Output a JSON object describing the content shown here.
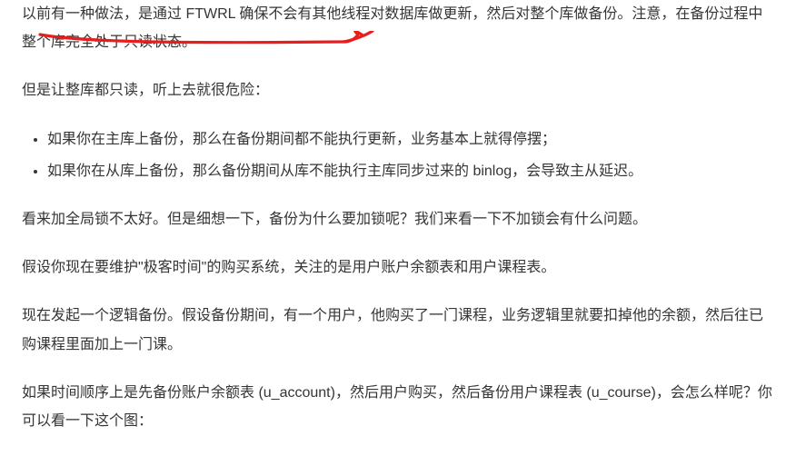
{
  "paragraphs": {
    "p1": "以前有一种做法，是通过 FTWRL 确保不会有其他线程对数据库做更新，然后对整个库做备份。注意，在备份过程中整个库完全处于只读状态。",
    "p2": "但是让整库都只读，听上去就很危险：",
    "p3": "看来加全局锁不太好。但是细想一下，备份为什么要加锁呢？我们来看一下不加锁会有什么问题。",
    "p4": "假设你现在要维护\"极客时间\"的购买系统，关注的是用户账户余额表和用户课程表。",
    "p5": "现在发起一个逻辑备份。假设备份期间，有一个用户，他购买了一门课程，业务逻辑里就要扣掉他的余额，然后往已购课程里面加上一门课。",
    "p6": "如果时间顺序上是先备份账户余额表 (u_account)，然后用户购买，然后备份用户课程表 (u_course)，会怎么样呢？你可以看一下这个图："
  },
  "bullets": {
    "b1": "如果你在主库上备份，那么在备份期间都不能执行更新，业务基本上就得停摆；",
    "b2": "如果你在从库上备份，那么备份期间从库不能执行主库同步过来的 binlog，会导致主从延迟。"
  }
}
